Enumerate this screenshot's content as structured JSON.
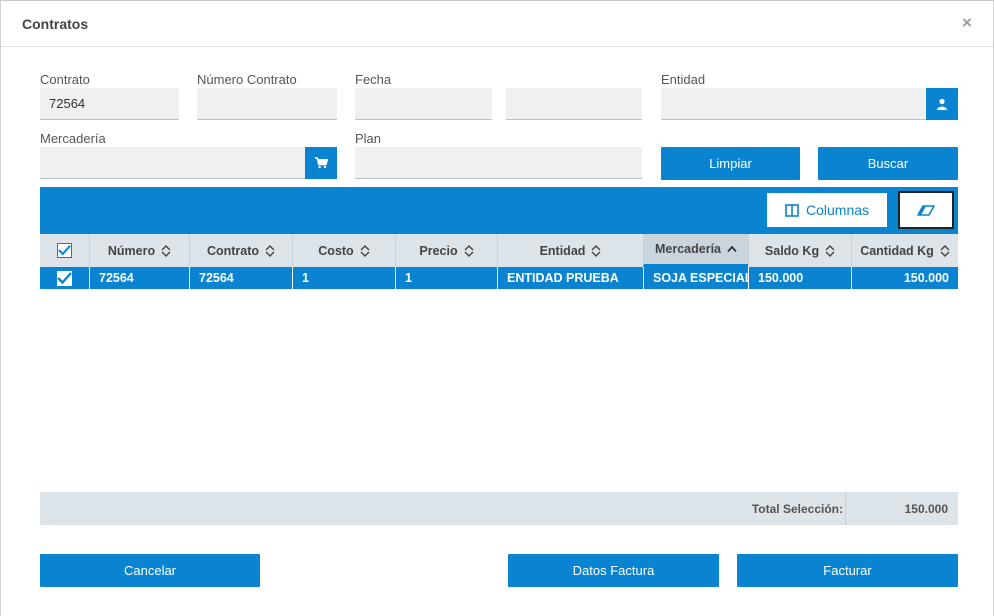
{
  "dialog": {
    "title": "Contratos",
    "close_glyph": "×"
  },
  "form": {
    "contrato": {
      "label": "Contrato",
      "value": "72564"
    },
    "numero_contrato": {
      "label": "Número Contrato",
      "value": ""
    },
    "fecha": {
      "label": "Fecha",
      "value_from": "",
      "value_to": ""
    },
    "entidad": {
      "label": "Entidad",
      "value": "",
      "icon": "user-icon"
    },
    "mercaderia": {
      "label": "Mercadería",
      "value": "",
      "icon": "cart-icon"
    },
    "plan": {
      "label": "Plan",
      "value": ""
    },
    "limpiar_label": "Limpiar",
    "buscar_label": "Buscar"
  },
  "toolbar": {
    "columns_label": "Columnas",
    "columns_icon": "columns-icon",
    "clear_icon": "eraser-icon"
  },
  "table": {
    "columns": [
      {
        "label": "Número",
        "sort": "none"
      },
      {
        "label": "Contrato",
        "sort": "none"
      },
      {
        "label": "Costo",
        "sort": "none"
      },
      {
        "label": "Precio",
        "sort": "none"
      },
      {
        "label": "Entidad",
        "sort": "none"
      },
      {
        "label": "Mercadería",
        "sort": "ascending"
      },
      {
        "label": "Saldo Kg",
        "sort": "none"
      },
      {
        "label": "Cantidad Kg",
        "sort": "none"
      }
    ],
    "rows": [
      {
        "selected": true,
        "cells": [
          "72564",
          "72564",
          "1",
          "1",
          "ENTIDAD PRUEBA",
          "SOJA ESPECIAL",
          "150.000",
          "150.000"
        ]
      }
    ]
  },
  "footer": {
    "total_label": "Total Selección:",
    "total_value": "150.000"
  },
  "actions": {
    "cancelar": "Cancelar",
    "datos_factura": "Datos Factura",
    "facturar": "Facturar"
  },
  "colors": {
    "accent": "#0a84d0",
    "header_bg": "#dce3e9",
    "input_bg": "#eef0f2"
  }
}
